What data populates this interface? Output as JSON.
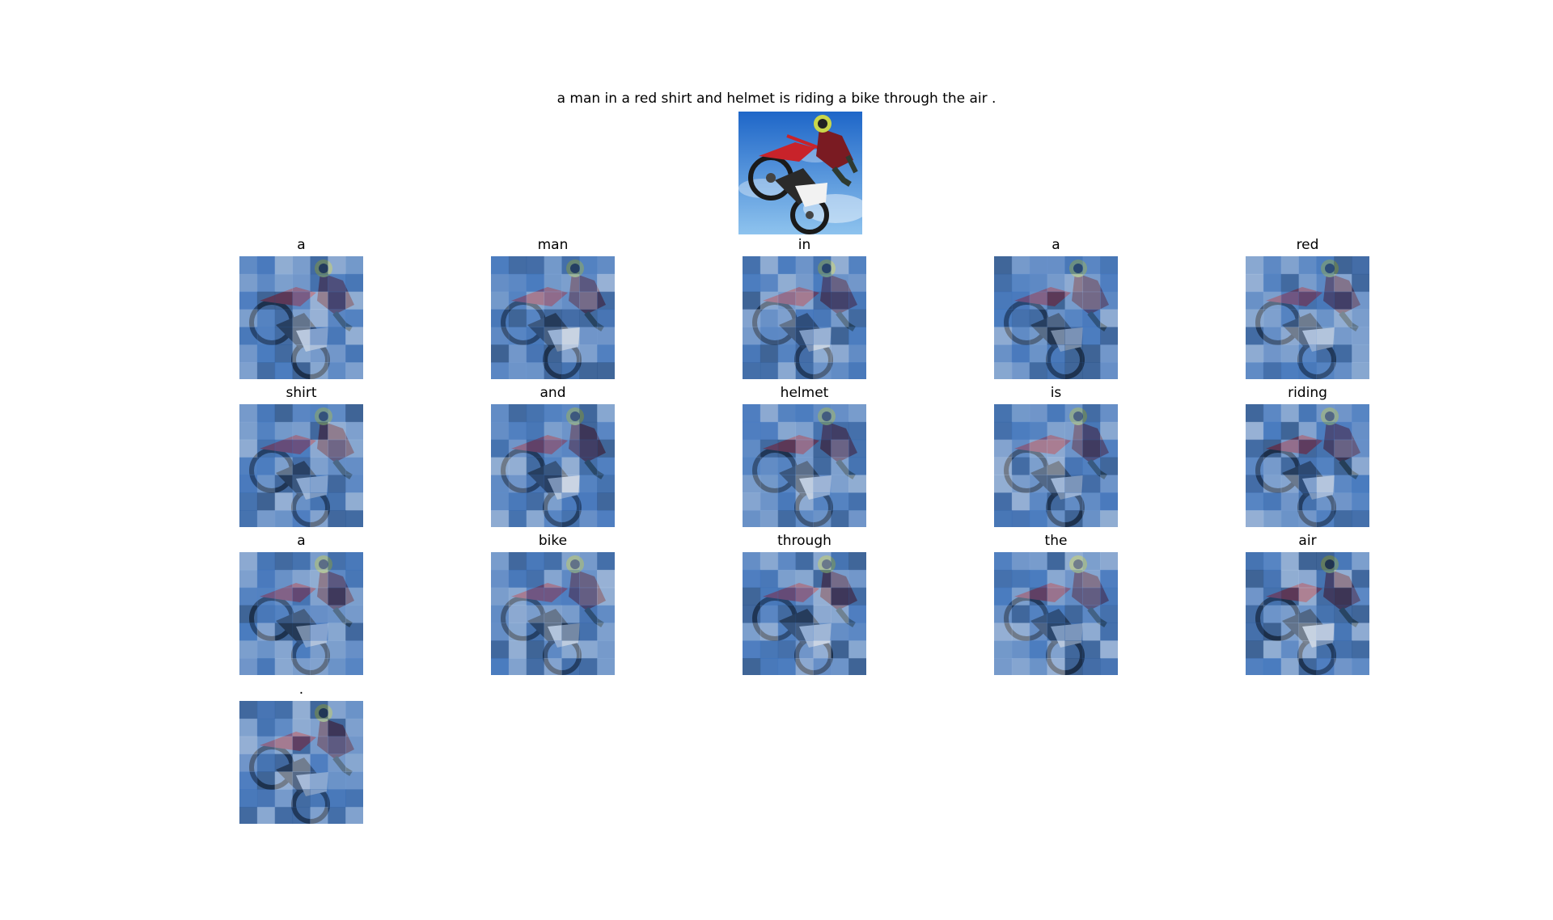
{
  "caption": "a man in a red shirt and helmet is riding a bike through the air .",
  "words": [
    "a",
    "man",
    "in",
    "a",
    "red",
    "shirt",
    "and",
    "helmet",
    "is",
    "riding",
    "a",
    "bike",
    "through",
    "the",
    "air",
    "."
  ],
  "colors": {
    "sky_top": "#1e66c8",
    "sky_bottom": "#8ec3ee",
    "attention_dark": "#0d2a5a",
    "attention_light": "#cfe3fb"
  },
  "icons": [
    "motocross-rider-image",
    "attention-overlay"
  ]
}
